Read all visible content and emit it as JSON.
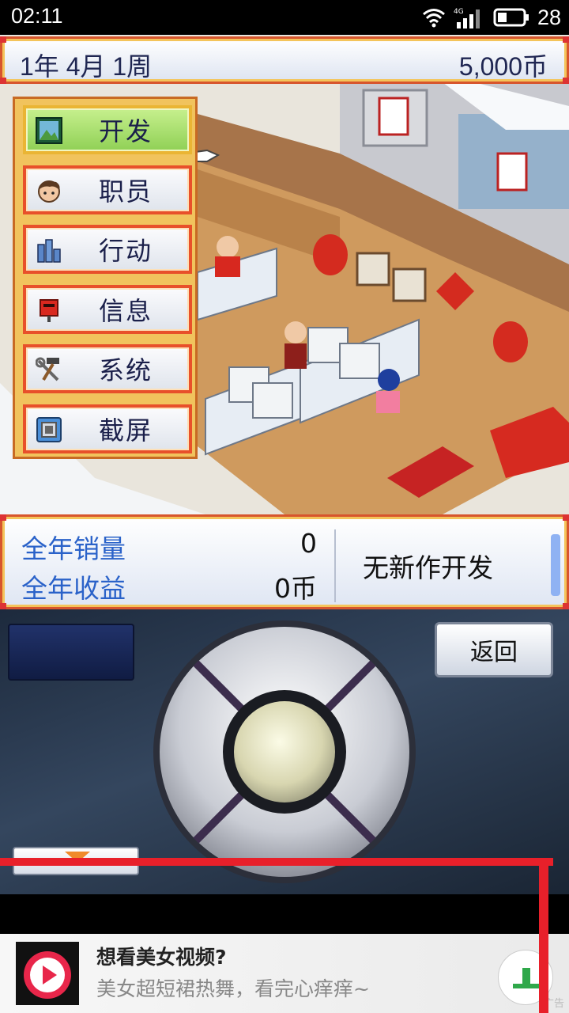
{
  "status_bar": {
    "time": "02:11",
    "network": "4G",
    "battery": "28"
  },
  "top_bar": {
    "date": "1年 4月 1周",
    "money": "5,000币"
  },
  "menu": {
    "items": [
      {
        "label": "开发",
        "icon": "monitor-icon",
        "active": true
      },
      {
        "label": "职员",
        "icon": "staff-face-icon",
        "active": false
      },
      {
        "label": "行动",
        "icon": "buildings-icon",
        "active": false
      },
      {
        "label": "信息",
        "icon": "mailbox-icon",
        "active": false
      },
      {
        "label": "系统",
        "icon": "tools-icon",
        "active": false
      },
      {
        "label": "截屏",
        "icon": "camera-icon",
        "active": false
      }
    ]
  },
  "stats": {
    "annual_sales_label": "全年销量",
    "annual_sales_value": "0",
    "annual_revenue_label": "全年收益",
    "annual_revenue_value": "0币",
    "dev_status": "无新作开发"
  },
  "controller": {
    "back_label": "返回"
  },
  "ad": {
    "title": "想看美女视频?",
    "description": "美女超短裙热舞，看完心痒痒~",
    "tag": "广告"
  },
  "colors": {
    "frame_red": "#d7552d",
    "frame_gold": "#f4c45a",
    "menu_active": "#8fd055",
    "text_blue": "#2a62c9",
    "overlay_red": "#e8202a"
  }
}
